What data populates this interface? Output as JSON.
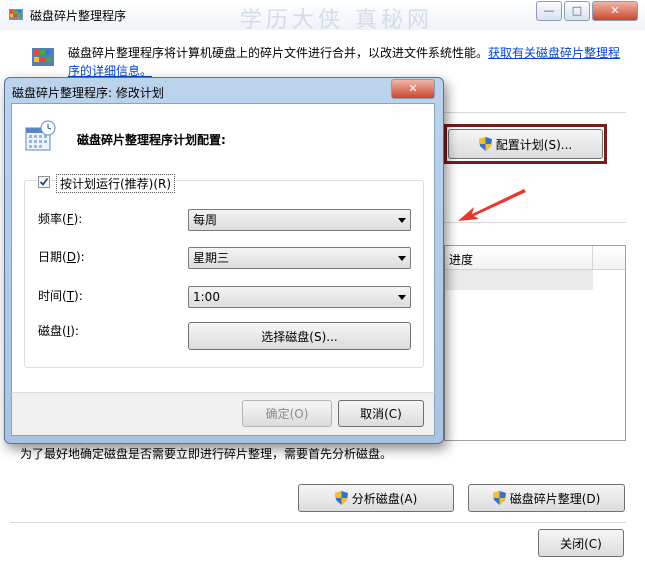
{
  "main_window": {
    "title": "磁盘碎片整理程序",
    "watermark": "学历大侠 真秘网",
    "controls": {
      "minimize": "—",
      "maximize": "□",
      "close": "✕"
    },
    "description": "磁盘碎片整理程序将计算机硬盘上的碎片文件进行合并，以改进文件系统性能。",
    "description_link": "获取有关磁盘碎片整理程序的详细信息。",
    "configure_button": "配置计划(S)...",
    "list_header_progress": "进度",
    "bottom_note": "为了最好地确定磁盘是否需要立即进行碎片整理，需要首先分析磁盘。",
    "analyze_button": "分析磁盘(A)",
    "defrag_button": "磁盘碎片整理(D)",
    "close_button": "关闭(C)"
  },
  "dialog": {
    "title": "磁盘碎片整理程序: 修改计划",
    "close": "✕",
    "heading": "磁盘碎片整理程序计划配置:",
    "schedule_checkbox": {
      "label": "按计划运行(推荐)(R)",
      "checked": true
    },
    "frequency": {
      "label_pre": "频率(",
      "label_key": "F",
      "label_post": "):",
      "value": "每周"
    },
    "day": {
      "label_pre": "日期(",
      "label_key": "D",
      "label_post": "):",
      "value": "星期三"
    },
    "time": {
      "label_pre": "时间(",
      "label_key": "T",
      "label_post": "):",
      "value": "1:00"
    },
    "disks": {
      "label_pre": "磁盘(",
      "label_key": "I",
      "label_post": "):",
      "button": "选择磁盘(S)..."
    },
    "ok_button": "确定(O)",
    "cancel_button": "取消(C)"
  },
  "colors": {
    "accent_border": "#7a1a1a",
    "arrow": "#e8382b",
    "dialog_frame": "#bcd3ec"
  }
}
